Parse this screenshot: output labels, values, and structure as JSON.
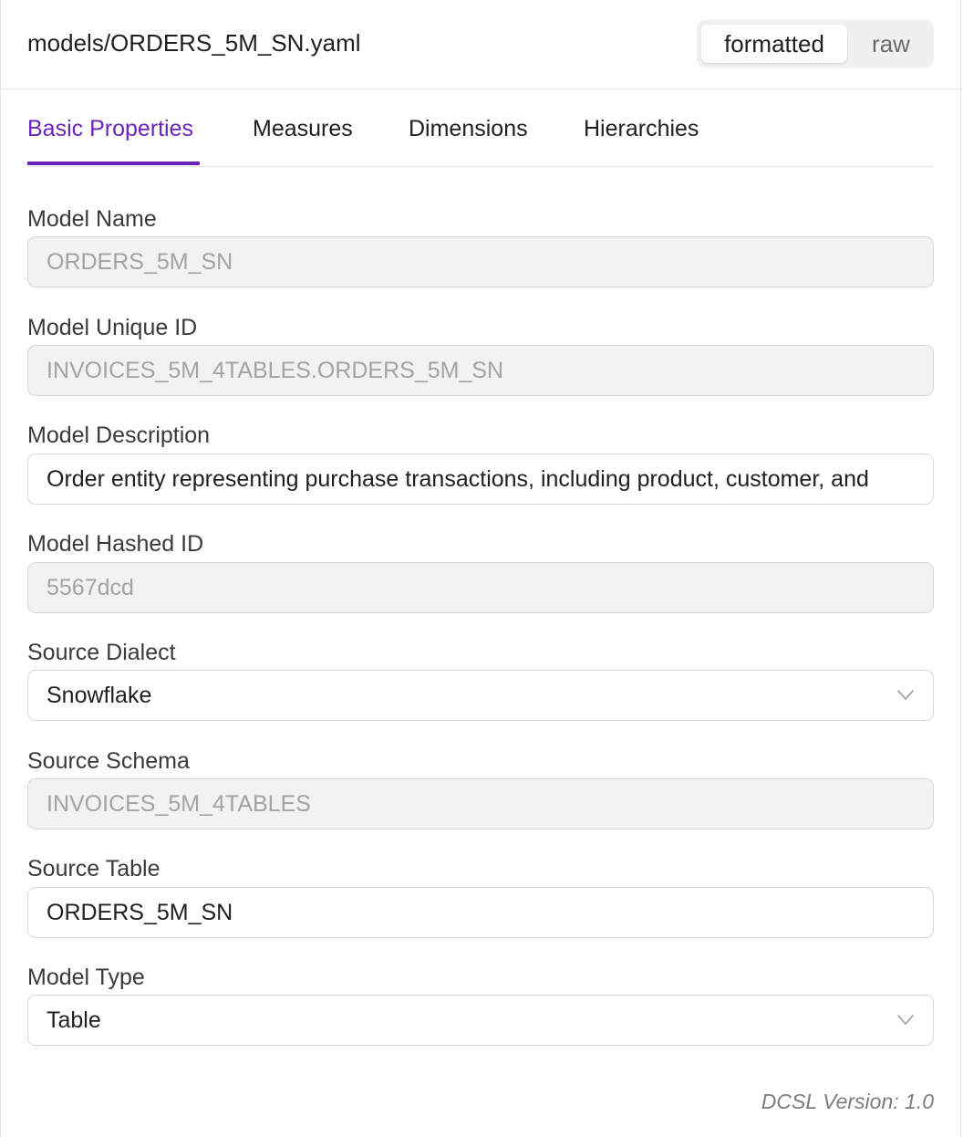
{
  "header": {
    "file_path": "models/ORDERS_5M_SN.yaml",
    "view_toggle": {
      "active": "formatted",
      "inactive": "raw"
    }
  },
  "tabs": [
    {
      "label": "Basic Properties",
      "active": true
    },
    {
      "label": "Measures",
      "active": false
    },
    {
      "label": "Dimensions",
      "active": false
    },
    {
      "label": "Hierarchies",
      "active": false
    }
  ],
  "form": {
    "model_name": {
      "label": "Model Name",
      "value": "ORDERS_5M_SN",
      "editable": false
    },
    "model_unique_id": {
      "label": "Model Unique ID",
      "value": "INVOICES_5M_4TABLES.ORDERS_5M_SN",
      "editable": false
    },
    "model_description": {
      "label": "Model Description",
      "value": "Order entity representing purchase transactions, including product, customer, and",
      "editable": true
    },
    "model_hashed_id": {
      "label": "Model Hashed ID",
      "value": "5567dcd",
      "editable": false
    },
    "source_dialect": {
      "label": "Source Dialect",
      "value": "Snowflake",
      "editable": true
    },
    "source_schema": {
      "label": "Source Schema",
      "value": "INVOICES_5M_4TABLES",
      "editable": false
    },
    "source_table": {
      "label": "Source Table",
      "value": "ORDERS_5M_SN",
      "editable": true
    },
    "model_type": {
      "label": "Model Type",
      "value": "Table",
      "editable": true
    }
  },
  "footer": {
    "version": "DCSL Version: 1.0"
  },
  "colors": {
    "accent": "#6a25b8",
    "disabled_bg": "#f2f2f2",
    "disabled_text": "#a3a3a3",
    "border": "#d7d7d7"
  },
  "icons": {
    "select_chevron": "chevron-down-icon"
  }
}
